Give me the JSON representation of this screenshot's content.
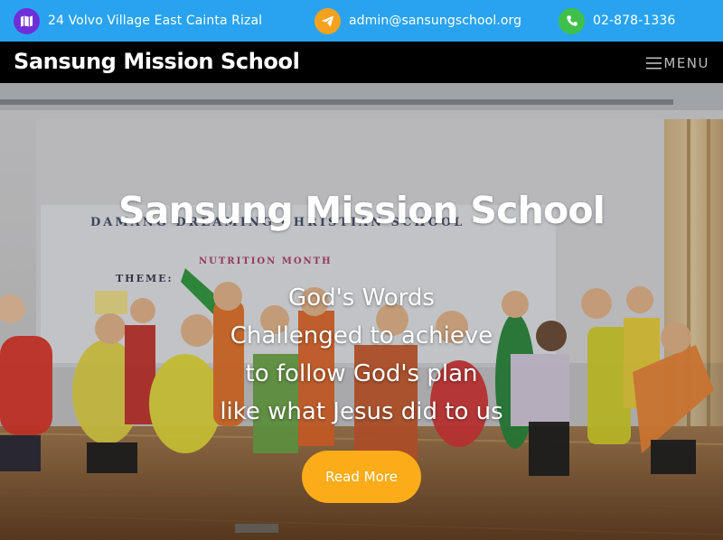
{
  "topbar": {
    "address": {
      "icon": "map-icon",
      "text": "24 Volvo Village East Cainta Rizal",
      "color": "#6e2fd8"
    },
    "email": {
      "icon": "paper-plane-icon",
      "text": "admin@sansungschool.org",
      "color": "#f6a21e"
    },
    "phone": {
      "icon": "phone-icon",
      "text": "02-878-1336",
      "color": "#3fc04a"
    }
  },
  "navbar": {
    "brand": "Sansung Mission School",
    "menu_label": "MENU"
  },
  "hero": {
    "title": "Sansung Mission School",
    "lines": [
      "God's Words",
      "Challenged to achieve",
      "to follow God's plan",
      "like what Jesus did to us"
    ],
    "button_label": "Read More",
    "banner_text": "DAMANG DREAMING CHRISTIAN SCHOOL",
    "banner_sub": "NUTRITION MONTH",
    "banner_theme": "THEME:"
  },
  "colors": {
    "topbar": "#29a3f0",
    "navbar": "#000000",
    "button": "#fbac18"
  }
}
